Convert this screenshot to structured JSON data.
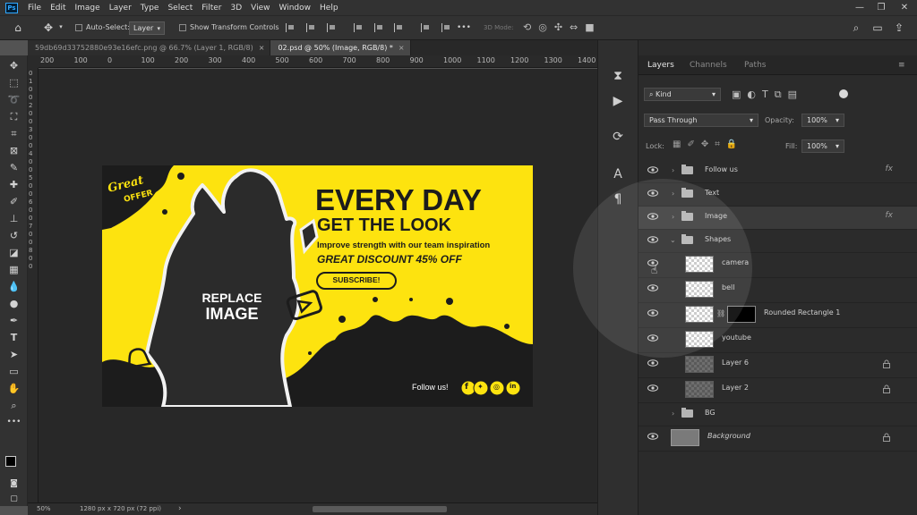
{
  "menu": {
    "items": [
      "File",
      "Edit",
      "Image",
      "Layer",
      "Type",
      "Select",
      "Filter",
      "3D",
      "View",
      "Window",
      "Help"
    ],
    "logo": "Ps"
  },
  "options": {
    "auto_select_label": "Auto-Select:",
    "auto_select_value": "Layer",
    "show_transform_label": "Show Transform Controls",
    "mode_3d_label": "3D Mode:",
    "more": "•••"
  },
  "tabs": [
    {
      "label": "59db69d33752880e93e16efc.png @ 66.7% (Layer 1, RGB/8)",
      "close": "×"
    },
    {
      "label": "02.psd @ 50% (Image, RGB/8) *",
      "close": "×"
    }
  ],
  "ruler": {
    "top": [
      "200",
      "100",
      "0",
      "100",
      "200",
      "300",
      "400",
      "500",
      "600",
      "700",
      "800",
      "900",
      "1000",
      "1100",
      "1200",
      "1300",
      "1400"
    ],
    "left": [
      "0",
      "1",
      "0",
      "0",
      "2",
      "0",
      "0",
      "3",
      "0",
      "0",
      "4",
      "0",
      "0",
      "5",
      "0",
      "0",
      "6",
      "0",
      "0",
      "7",
      "0",
      "0",
      "8",
      "0",
      "0"
    ]
  },
  "artwork": {
    "badge_line1": "Great",
    "badge_line2": "OFFER",
    "placeholder_line1": "REPLACE",
    "placeholder_line2": "IMAGE",
    "headline": "EVERY DAY",
    "subheadline": "GET THE LOOK",
    "tagline": "Improve strength with our team inspiration",
    "discount": "GREAT DISCOUNT 45% OFF",
    "cta": "SUBSCRIBE!",
    "follow": "Follow us!",
    "colors": {
      "yellow": "#fde30f",
      "dark": "#1c1c1c",
      "silhouette": "#2b2b2b"
    }
  },
  "status": {
    "zoom": "50%",
    "doc_info": "1280 px x 720 px (72 ppi)",
    "arrow": "›"
  },
  "layers_panel": {
    "tabs": [
      "Layers",
      "Channels",
      "Paths"
    ],
    "filter_kind": "Kind",
    "blend_mode": "Pass Through",
    "opacity_label": "Opacity:",
    "opacity_value": "100%",
    "lock_label": "Lock:",
    "fill_label": "Fill:",
    "fill_value": "100%",
    "layers": [
      {
        "name": "Follow us",
        "kind": "group",
        "fx": "fx"
      },
      {
        "name": "Text",
        "kind": "group"
      },
      {
        "name": "Image",
        "kind": "group",
        "fx": "fx"
      },
      {
        "name": "Shapes",
        "kind": "group-open"
      },
      {
        "name": "camera",
        "kind": "smart"
      },
      {
        "name": "bell",
        "kind": "smart"
      },
      {
        "name": "Rounded Rectangle 1",
        "kind": "shape-mask"
      },
      {
        "name": "youtube",
        "kind": "smart"
      },
      {
        "name": "Layer 6",
        "kind": "pixel",
        "locked": true
      },
      {
        "name": "Layer 2",
        "kind": "pixel",
        "locked": true
      },
      {
        "name": "BG",
        "kind": "group"
      },
      {
        "name": "Background",
        "kind": "background",
        "locked": true
      }
    ]
  }
}
